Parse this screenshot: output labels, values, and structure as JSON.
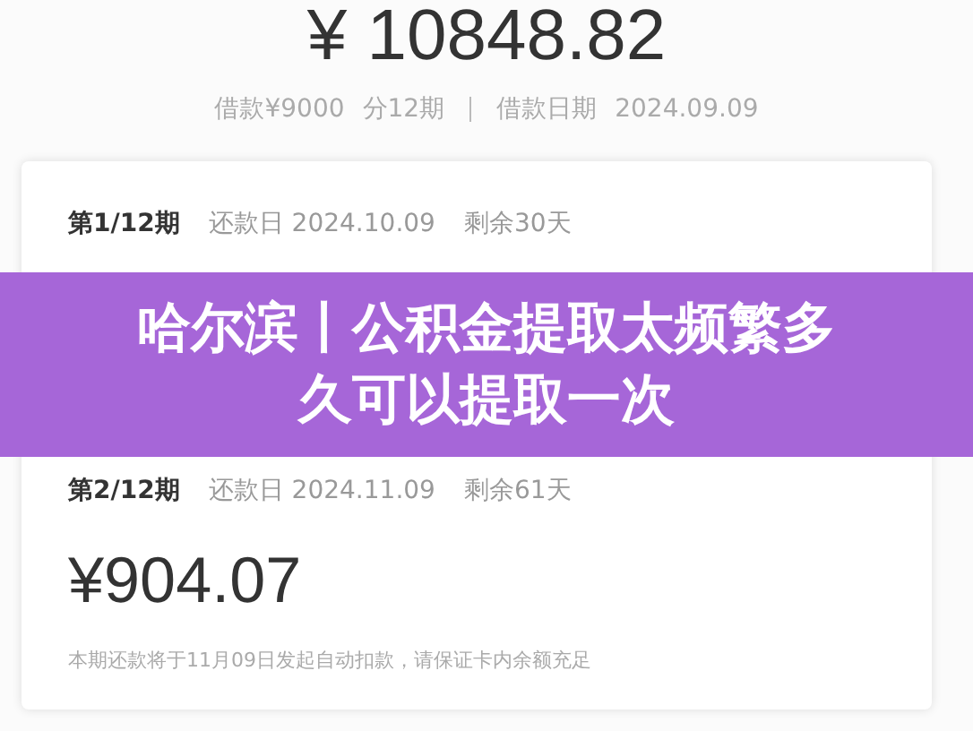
{
  "total_amount": "¥ 10848.82",
  "loan_summary": {
    "amount": "借款¥9000",
    "terms": "分12期",
    "date_label": "借款日期",
    "date": "2024.09.09"
  },
  "installments": [
    {
      "period": "第1/12期",
      "due_label": "还款日 2024.10.09",
      "remaining": "剩余30天"
    },
    {
      "period": "第2/12期",
      "due_label": "还款日 2024.11.09",
      "remaining": "剩余61天",
      "amount": "¥904.07",
      "note": "本期还款将于11月09日发起自动扣款，请保证卡内余额充足"
    }
  ],
  "banner": {
    "title": "哈尔滨丨公积金提取太频繁多久可以提取一次"
  }
}
